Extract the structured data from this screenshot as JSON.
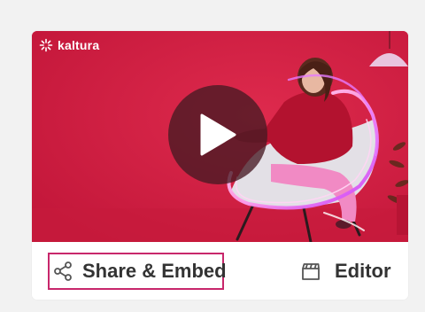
{
  "player": {
    "brand_name": "kaltura",
    "brand_icon": "kaltura-logo-icon",
    "play_icon": "play-icon",
    "background_color": "#d21f42"
  },
  "actions": {
    "share_label": "Share & Embed",
    "share_icon": "share-icon",
    "editor_label": "Editor",
    "editor_icon": "clapperboard-icon",
    "highlight_color": "#c8276b"
  }
}
